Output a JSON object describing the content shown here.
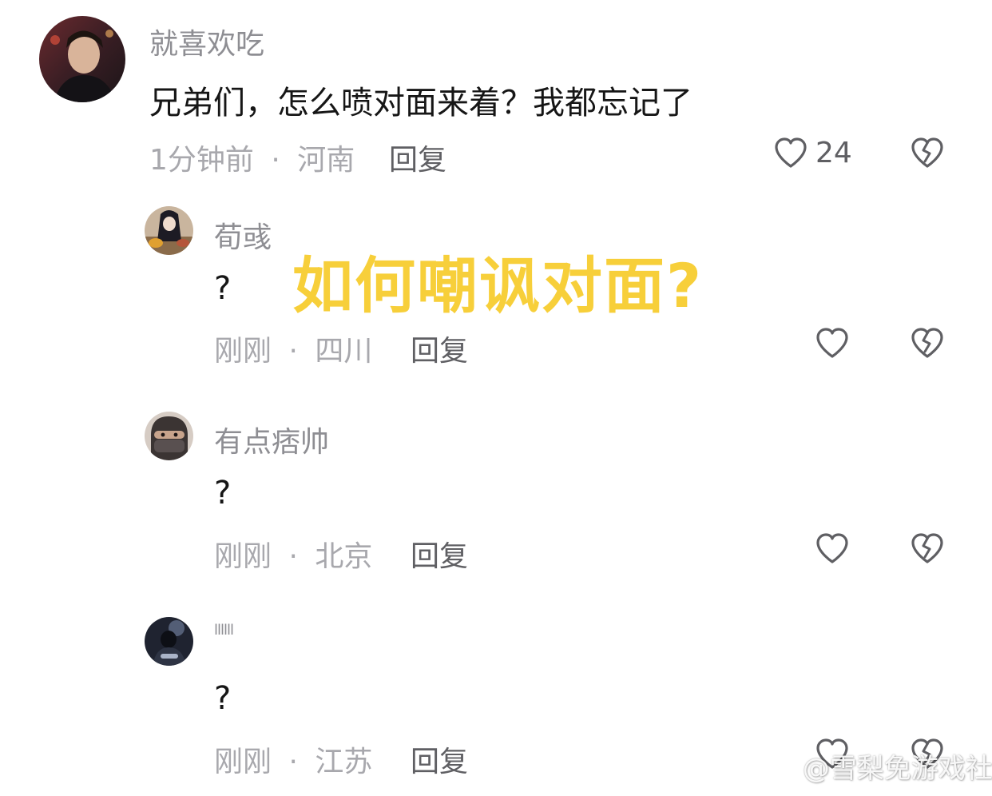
{
  "comments": [
    {
      "username": "就喜欢吃",
      "text": "兄弟们，怎么喷对面来着？我都忘记了",
      "time": "1分钟前",
      "location": "河南",
      "separator": "·",
      "reply_label": "回复",
      "like_count": "24",
      "like_icon": "heart-outline-icon",
      "dislike_icon": "broken-heart-icon"
    },
    {
      "username": "荀彧",
      "text": "?",
      "time": "刚刚",
      "location": "四川",
      "separator": "·",
      "reply_label": "回复",
      "like_icon": "heart-outline-icon",
      "dislike_icon": "broken-heart-icon"
    },
    {
      "username": "有点痞帅",
      "text": "?",
      "time": "刚刚",
      "location": "北京",
      "separator": "·",
      "reply_label": "回复",
      "like_icon": "heart-outline-icon",
      "dislike_icon": "broken-heart-icon"
    },
    {
      "username": "llllll",
      "text": "?",
      "time": "刚刚",
      "location": "江苏",
      "separator": "·",
      "reply_label": "回复",
      "like_icon": "heart-outline-icon",
      "dislike_icon": "broken-heart-icon"
    }
  ],
  "overlay": {
    "title": "如何嘲讽对面?"
  },
  "watermark": {
    "text": "@雪梨免游戏社"
  },
  "colors": {
    "overlay_yellow": "#f7cf3a",
    "username_gray": "#8e8e93",
    "meta_gray": "#a8a8ad",
    "icon_gray": "#5f5f63"
  }
}
